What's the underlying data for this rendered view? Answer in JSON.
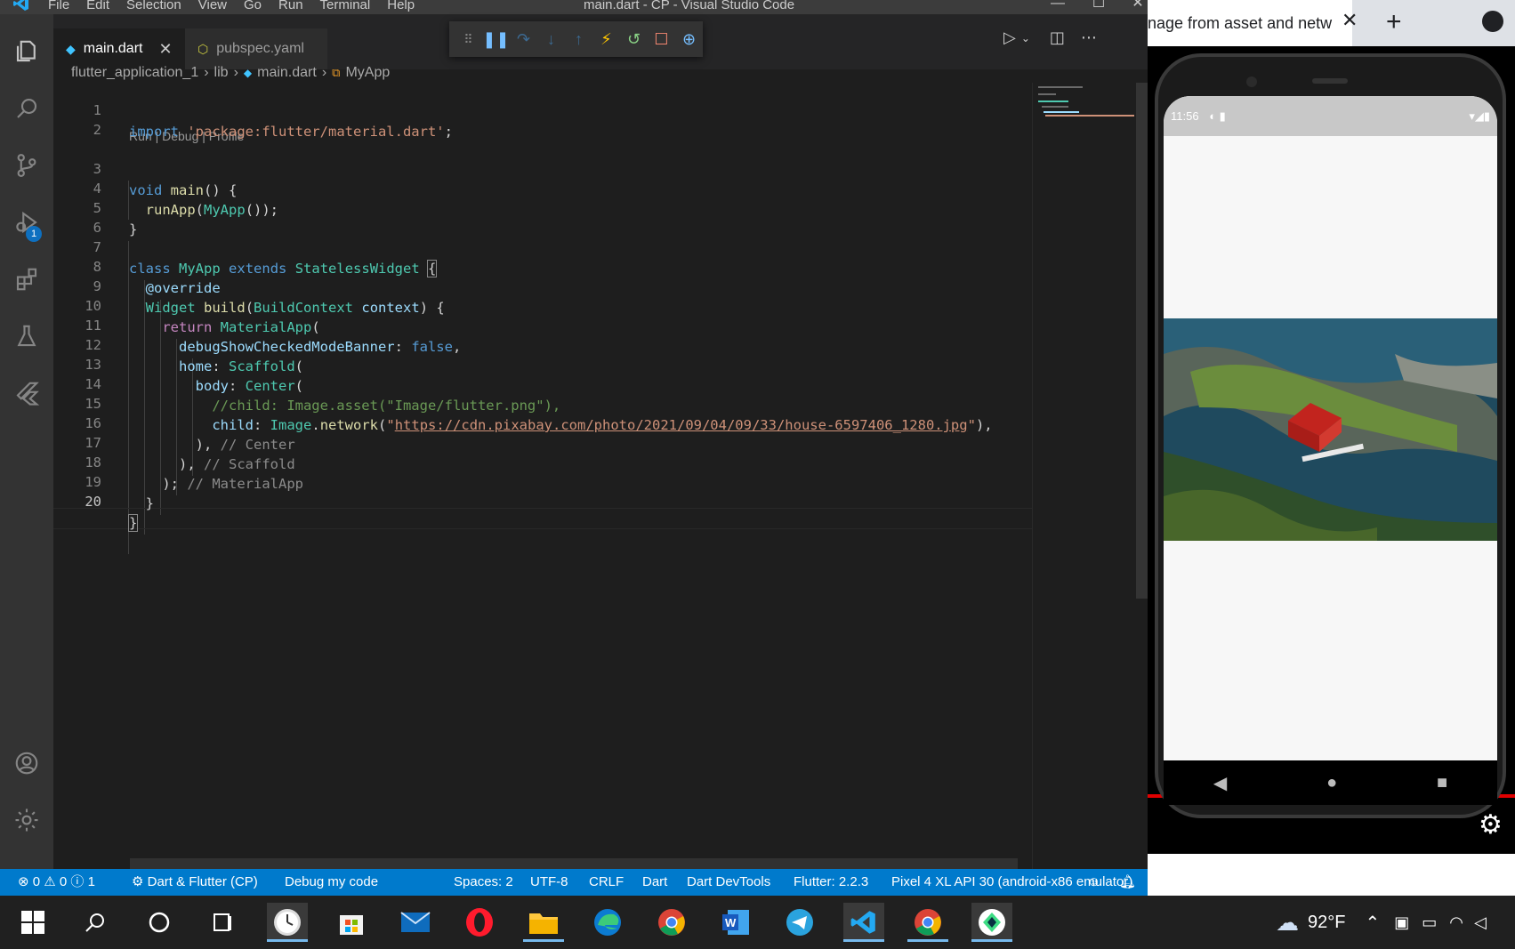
{
  "window": {
    "title": "main.dart - CP - Visual Studio Code",
    "menu": [
      "File",
      "Edit",
      "Selection",
      "View",
      "Go",
      "Run",
      "Terminal",
      "Help"
    ]
  },
  "activity_bar": {
    "icons": [
      "explorer-icon",
      "search-icon",
      "source-control-icon",
      "run-debug-icon",
      "extensions-icon",
      "testing-icon",
      "flutter-icon",
      "account-icon",
      "settings-gear-icon"
    ],
    "run_debug_badge": "1"
  },
  "tabs": [
    {
      "label": "main.dart",
      "active": true,
      "icon": "dart-file-icon"
    },
    {
      "label": "pubspec.yaml",
      "active": false,
      "icon": "yaml-file-icon"
    }
  ],
  "debug_toolbar": [
    "drag-handle-icon",
    "pause-icon",
    "step-over-icon",
    "step-into-icon",
    "step-out-icon",
    "hot-reload-icon",
    "hot-restart-icon",
    "stop-icon",
    "devtools-icon"
  ],
  "breadcrumb": [
    "flutter_application_1",
    "lib",
    "main.dart",
    "MyApp"
  ],
  "code_lens": "Run | Debug | Profile",
  "code": {
    "lines": [
      {
        "n": "1"
      },
      {
        "n": "2"
      },
      {
        "n": "3"
      },
      {
        "n": "4"
      },
      {
        "n": "5"
      },
      {
        "n": "6"
      },
      {
        "n": "7"
      },
      {
        "n": "8"
      },
      {
        "n": "9"
      },
      {
        "n": "10"
      },
      {
        "n": "11"
      },
      {
        "n": "12"
      },
      {
        "n": "13"
      },
      {
        "n": "14"
      },
      {
        "n": "15"
      },
      {
        "n": "16"
      },
      {
        "n": "17"
      },
      {
        "n": "18"
      },
      {
        "n": "19"
      },
      {
        "n": "20"
      }
    ],
    "t1_import": "import",
    "t1_str": "'package:flutter/material.dart'",
    "t1_end": ";",
    "t3_void": "void",
    "t3_main": "main",
    "t3_rest": "() {",
    "t4_runapp": "runApp",
    "t4_open": "(",
    "t4_myapp": "MyApp",
    "t4_rest": "());",
    "t5": "}",
    "t7_class": "class",
    "t7_myapp": "MyApp",
    "t7_extends": "extends",
    "t7_sw": "StatelessWidget",
    "t7_brace": "{",
    "t8": "@override",
    "t9_widget": "Widget",
    "t9_build": "build",
    "t9_open": "(",
    "t9_bc": "BuildContext",
    "t9_ctx": "context",
    "t9_rest": ") {",
    "t10_return": "return",
    "t10_ma": "MaterialApp",
    "t10_open": "(",
    "t11_key": "debugShowCheckedModeBanner",
    "t11_colon": ": ",
    "t11_false": "false",
    "t11_comma": ",",
    "t12_key": "home",
    "t12_colon": ": ",
    "t12_scaffold": "Scaffold",
    "t12_open": "(",
    "t13_key": "body",
    "t13_colon": ": ",
    "t13_center": "Center",
    "t13_open": "(",
    "t14_comment": "//child: Image.asset(\"Image/flutter.png\"),",
    "t15_key": "child",
    "t15_colon": ": ",
    "t15_image": "Image",
    "t15_dot": ".",
    "t15_network": "network",
    "t15_open": "(",
    "t15_q1": "\"",
    "t15_url": "https://cdn.pixabay.com/photo/2021/09/04/09/33/house-6597406_1280.jpg",
    "t15_q2": "\"",
    "t15_end": "),",
    "t16_code": "),",
    "t16_hint": " // Center",
    "t17_code": "),",
    "t17_hint": " // Scaffold",
    "t18_code": ");",
    "t18_hint": " // MaterialApp",
    "t19": "}",
    "t20": "}"
  },
  "statusbar": {
    "errors": "0",
    "warnings": "0",
    "infos": "1",
    "debug_config": "Dart & Flutter (CP)",
    "debug_mode": "Debug my code",
    "spaces": "Spaces: 2",
    "encoding": "UTF-8",
    "eol": "CRLF",
    "language": "Dart",
    "devtools": "Dart DevTools",
    "flutter_version": "Flutter: 2.2.3",
    "device": "Pixel 4 XL API 30 (android-x86 emulator)",
    "color": "#007acc"
  },
  "browser": {
    "tab_title": "nage from asset and netw",
    "tab_close": "✕",
    "new_tab": "+"
  },
  "emulator": {
    "clock": "11:56",
    "nav": [
      "back-icon",
      "home-icon",
      "recents-icon"
    ]
  },
  "taskbar": {
    "apps": [
      "start-icon",
      "search-icon",
      "cortana-icon",
      "task-view-icon",
      "clock-app-icon",
      "store-icon",
      "mail-icon",
      "opera-icon",
      "file-explorer-icon",
      "edge-icon",
      "chrome-icon",
      "word-icon",
      "telegram-icon",
      "vscode-icon",
      "chrome-icon-2",
      "android-studio-icon"
    ],
    "temperature": "92°F"
  },
  "colors": {
    "accent": "#007acc",
    "editor_bg": "#1e1e1e",
    "keyword": "#569cd6",
    "type": "#4ec9b0",
    "string": "#ce9178",
    "comment": "#6a9955"
  }
}
